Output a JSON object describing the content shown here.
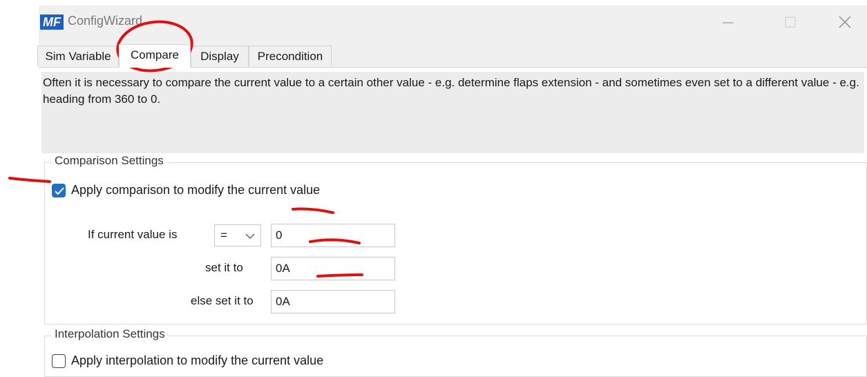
{
  "window": {
    "title": "ConfigWizard",
    "icon_text": "MF",
    "controls": [
      "minimize-icon",
      "maximize-icon",
      "close-icon"
    ]
  },
  "tabs": [
    {
      "label": "Sim Variable",
      "active": false
    },
    {
      "label": "Compare",
      "active": true
    },
    {
      "label": "Display",
      "active": false
    },
    {
      "label": "Precondition",
      "active": false
    }
  ],
  "description": "Often it is necessary to compare the current value to a certain other value - e.g. determine flaps extension - and sometimes even set to a different value - e.g. heading from 360 to 0.",
  "comparison": {
    "legend": "Comparison Settings",
    "apply_label": "Apply comparison to modify the current value",
    "apply_checked": true,
    "if_label": "If current value is",
    "operator": "=",
    "compare_value": "0",
    "set_label": "set it to",
    "set_value": "0A",
    "else_label": "else set it to",
    "else_value": "0A"
  },
  "interpolation": {
    "legend": "Interpolation Settings",
    "apply_label": "Apply interpolation to modify the current value",
    "apply_checked": false
  },
  "annotation_color": "#e01010",
  "accent_color": "#1f6fc4"
}
